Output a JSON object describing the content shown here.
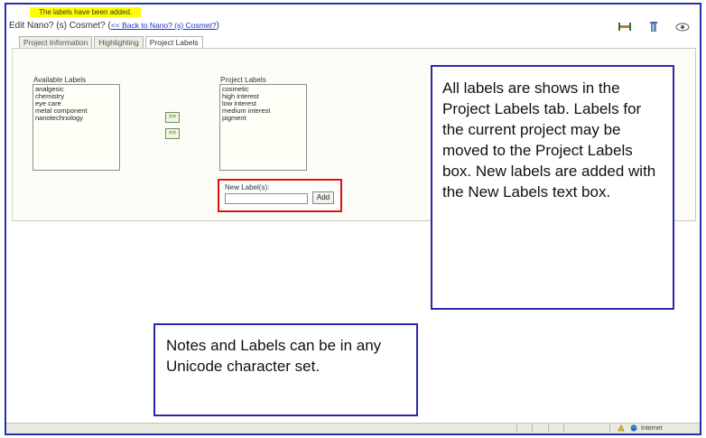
{
  "banner": "The labels have been added.",
  "header": {
    "title": "Edit Nano? (s) Cosmet?",
    "back_link": "<< Back to Nano? (s) Cosmet?"
  },
  "tabs": [
    {
      "label": "Project Information",
      "active": false
    },
    {
      "label": "Highlighting",
      "active": false
    },
    {
      "label": "Project Labels",
      "active": true
    }
  ],
  "available_labels": {
    "heading": "Available Labels",
    "items": [
      "analgesic",
      "chemistry",
      "eye care",
      "metal component",
      "nanotechnology"
    ]
  },
  "project_labels": {
    "heading": "Project Labels",
    "items": [
      "cosmetic",
      "high interest",
      "low interest",
      "medium interest",
      "pigment"
    ]
  },
  "move_buttons": {
    "right": ">>",
    "left": "<<"
  },
  "new_label": {
    "label": "New Label(s):",
    "value": "",
    "add_button": "Add"
  },
  "callouts": {
    "labels_note": "All labels are shows in the Project Labels tab. Labels for the current project may be moved to the Project Labels box. New labels are added with the New Labels text box.",
    "unicode_note": "Notes and Labels can be in any Unicode character set."
  },
  "statusbar": {
    "zone": "Internet"
  },
  "colors": {
    "banner_bg": "#ffff00",
    "callout_border": "#2a2aa8",
    "highlight_border": "#e01010",
    "link": "#1a33cc"
  },
  "icons": [
    "ruler-icon",
    "trash-icon",
    "eye-icon",
    "lock-icon",
    "globe-icon"
  ]
}
